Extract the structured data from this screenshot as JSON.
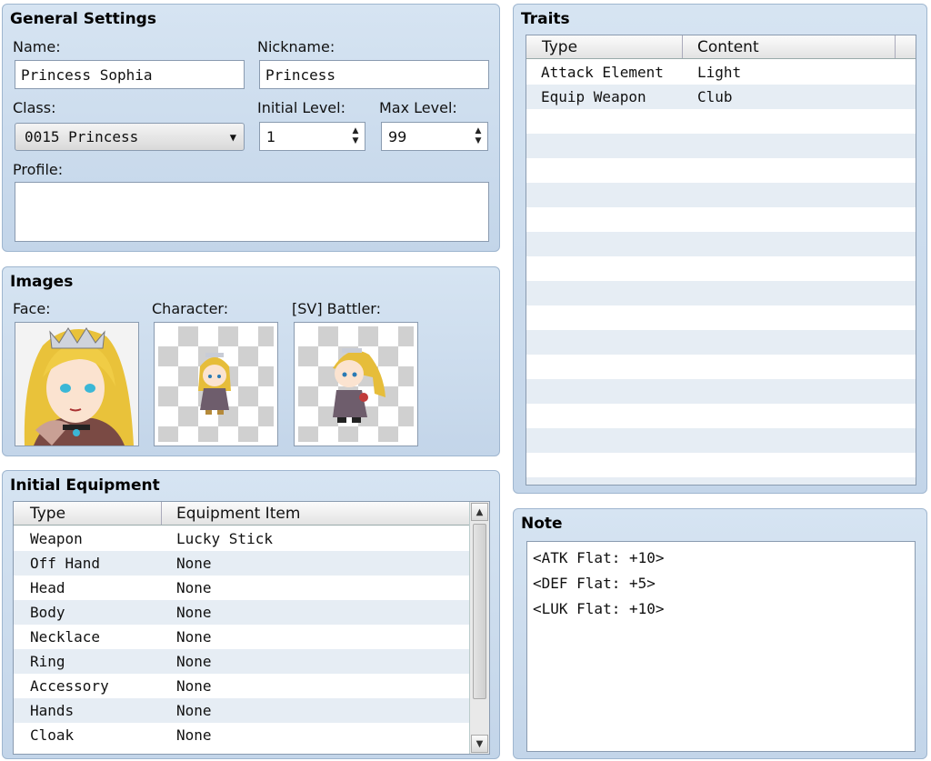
{
  "general": {
    "title": "General Settings",
    "name_label": "Name:",
    "name_value": "Princess Sophia",
    "nickname_label": "Nickname:",
    "nickname_value": "Princess",
    "class_label": "Class:",
    "class_value": "0015 Princess",
    "initial_level_label": "Initial Level:",
    "initial_level_value": "1",
    "max_level_label": "Max Level:",
    "max_level_value": "99",
    "profile_label": "Profile:",
    "profile_value": ""
  },
  "images": {
    "title": "Images",
    "face_label": "Face:",
    "character_label": "Character:",
    "battler_label": "[SV] Battler:"
  },
  "equipment": {
    "title": "Initial Equipment",
    "headers": [
      "Type",
      "Equipment Item"
    ],
    "rows": [
      {
        "type": "Weapon",
        "item": "Lucky Stick"
      },
      {
        "type": "Off Hand",
        "item": "None"
      },
      {
        "type": "Head",
        "item": "None"
      },
      {
        "type": "Body",
        "item": "None"
      },
      {
        "type": "Necklace",
        "item": "None"
      },
      {
        "type": "Ring",
        "item": "None"
      },
      {
        "type": "Accessory",
        "item": "None"
      },
      {
        "type": "Hands",
        "item": "None"
      },
      {
        "type": "Cloak",
        "item": "None"
      }
    ]
  },
  "traits": {
    "title": "Traits",
    "headers": [
      "Type",
      "Content"
    ],
    "rows": [
      {
        "type": "Attack Element",
        "content": "Light"
      },
      {
        "type": "Equip Weapon",
        "content": "Club"
      }
    ]
  },
  "note": {
    "title": "Note",
    "lines": [
      "<ATK Flat: +10>",
      "<DEF Flat: +5>",
      "<LUK Flat: +10>"
    ]
  },
  "colors": {
    "panel_bg": "#c9d9ec",
    "alt_row": "#e6edf4"
  }
}
